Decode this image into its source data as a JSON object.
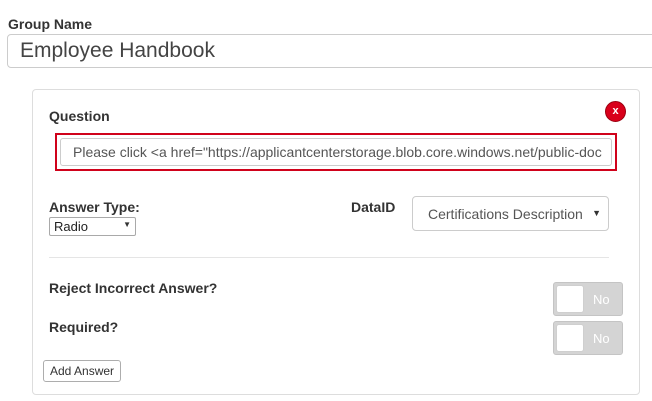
{
  "group": {
    "label": "Group Name",
    "value": "Employee Handbook"
  },
  "question_panel": {
    "question_label": "Question",
    "close_label": "x",
    "question_value": "Please click <a href=\"https://applicantcenterstorage.blob.core.windows.net/public-doc",
    "answer_type_label": "Answer Type:",
    "answer_type_value": "Radio",
    "data_id_label": "DataID",
    "data_id_value": "Certifications Description",
    "reject_label": "Reject Incorrect Answer?",
    "reject_toggle": {
      "state": "No"
    },
    "required_label": "Required?",
    "required_toggle": {
      "state": "No"
    },
    "add_answer_label": "Add Answer"
  },
  "icons": {
    "close": "close-icon",
    "dropdown": "chevron-down-icon"
  },
  "colors": {
    "close_button": "#d9001b",
    "highlight_border": "#d0021b",
    "toggle_off": "#d4d4d4"
  }
}
